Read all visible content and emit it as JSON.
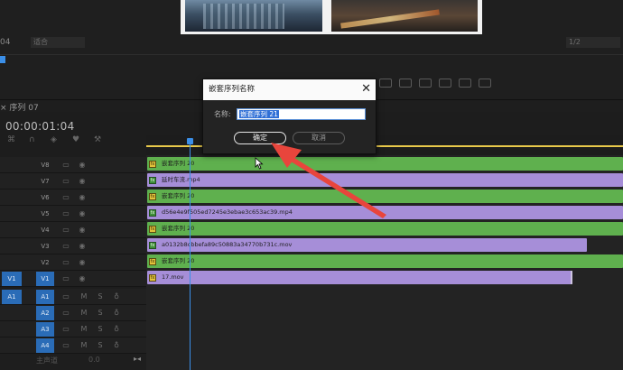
{
  "monitor": {
    "number": "04",
    "fit_value": "适合",
    "resolution_value": "1/2"
  },
  "timeline": {
    "tab_label": "序列 07",
    "timecode": "00:00:01:04",
    "bottom_label": "主声道",
    "bottom_value": "0.0"
  },
  "tracks": {
    "video": [
      {
        "label": "V8"
      },
      {
        "label": "V7"
      },
      {
        "label": "V6"
      },
      {
        "label": "V5"
      },
      {
        "label": "V4"
      },
      {
        "label": "V3"
      },
      {
        "label": "V2"
      },
      {
        "label": "V1",
        "source": "V1"
      }
    ],
    "audio": [
      {
        "label": "A1",
        "source": "A1"
      },
      {
        "label": "A2"
      },
      {
        "label": "A3"
      },
      {
        "label": "A4"
      }
    ]
  },
  "clips": [
    {
      "name": "嵌套序列 20",
      "color": "green",
      "fx": "fx"
    },
    {
      "name": "延时车流.mp4",
      "color": "purple",
      "fx": "fx"
    },
    {
      "name": "嵌套序列 20",
      "color": "green",
      "fx": "fx"
    },
    {
      "name": "d56e4e9f505ed7245e3ebae3c653ac39.mp4",
      "color": "purple",
      "fx": "fx"
    },
    {
      "name": "嵌套序列 20",
      "color": "green",
      "fx": "fx"
    },
    {
      "name": "a0132b8cbbefa89c50883a34770b731c.mov",
      "color": "purple",
      "fx": "fx"
    },
    {
      "name": "嵌套序列 20",
      "color": "green",
      "fx": "fx"
    },
    {
      "name": "17.mov",
      "color": "purple",
      "fx": "fx"
    }
  ],
  "dialog": {
    "title": "嵌套序列名称",
    "close": "✕",
    "name_label": "名称:",
    "name_value": "嵌套序列 21",
    "ok_label": "确定",
    "cancel_label": "取消"
  },
  "colors": {
    "clip_green": "#5fb04e",
    "clip_purple": "#a68ed8",
    "target_blue": "#2a6cb7",
    "playhead_blue": "#3b8fe8",
    "arrow_red": "#e8453c"
  },
  "icons": {
    "track_lock": "lock-icon",
    "track_eye": "eye-icon",
    "track_film": "film-icon",
    "mic": "mic-icon"
  }
}
